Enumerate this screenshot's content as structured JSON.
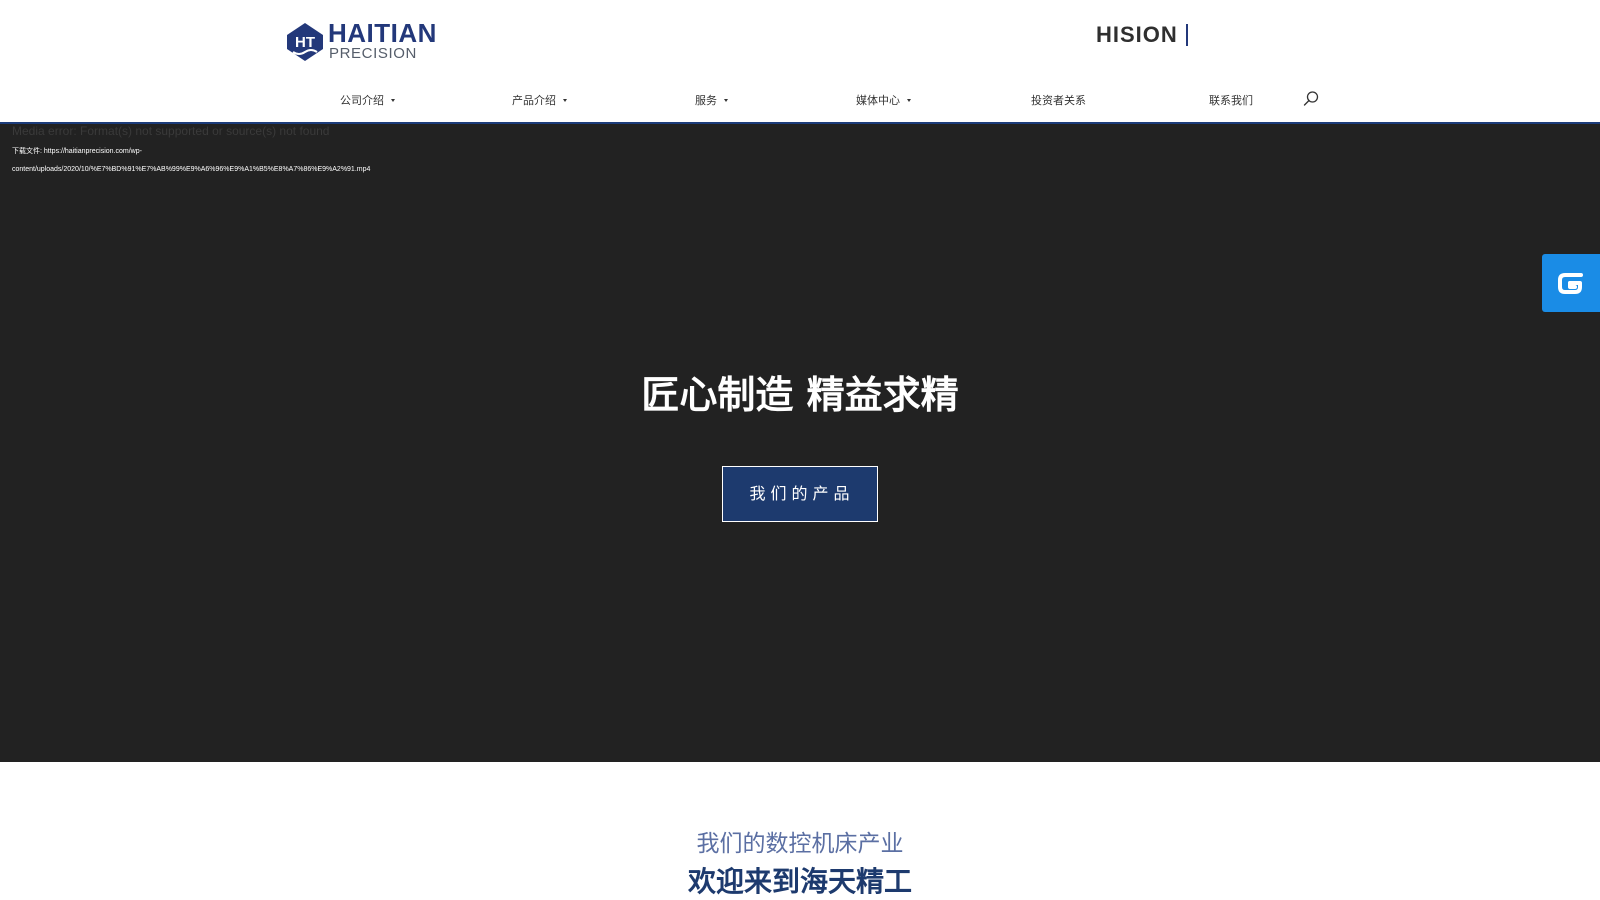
{
  "header": {
    "logo": {
      "word": "HAITIAN",
      "sub": "PRECISION",
      "mark": "HT"
    },
    "partner_logo": {
      "word": "HISION"
    },
    "nav": [
      {
        "label": "公司介绍",
        "has_dropdown": true
      },
      {
        "label": "产品介绍",
        "has_dropdown": true
      },
      {
        "label": "服务",
        "has_dropdown": true
      },
      {
        "label": "媒体中心",
        "has_dropdown": true
      },
      {
        "label": "投资者关系",
        "has_dropdown": false
      },
      {
        "label": "联系我们",
        "has_dropdown": false
      }
    ],
    "search_icon": "search-icon"
  },
  "hero": {
    "media_error": "Media error: Format(s) not supported or source(s) not found",
    "download_label": "下载文件: https://haitianprecision.com/wp-",
    "download_url": "content/uploads/2020/10/%E7%BD%91%E7%AB%99%E9%A6%96%E9%A1%B5%E8%A7%86%E9%A2%91.mp4",
    "title": "匠心制造 精益求精",
    "button_label": "我们的产品"
  },
  "side_widget": {
    "icon": "chat-widget-icon"
  },
  "intro": {
    "subtitle": "我们的数控机床产业",
    "title": "欢迎来到海天精工"
  },
  "colors": {
    "brand_blue": "#23387a",
    "nav_rule": "#1c3c7a",
    "hero_bg": "#222222",
    "button_bg": "#1d3a6e",
    "widget_blue": "#1a8ce6"
  }
}
